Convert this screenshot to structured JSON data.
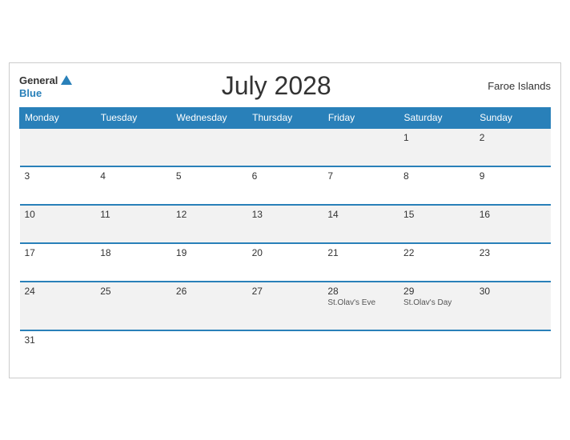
{
  "header": {
    "logo_general": "General",
    "logo_blue": "Blue",
    "month_title": "July 2028",
    "region": "Faroe Islands"
  },
  "weekdays": [
    "Monday",
    "Tuesday",
    "Wednesday",
    "Thursday",
    "Friday",
    "Saturday",
    "Sunday"
  ],
  "weeks": [
    [
      {
        "day": "",
        "event": ""
      },
      {
        "day": "",
        "event": ""
      },
      {
        "day": "",
        "event": ""
      },
      {
        "day": "",
        "event": ""
      },
      {
        "day": "",
        "event": ""
      },
      {
        "day": "1",
        "event": ""
      },
      {
        "day": "2",
        "event": ""
      }
    ],
    [
      {
        "day": "3",
        "event": ""
      },
      {
        "day": "4",
        "event": ""
      },
      {
        "day": "5",
        "event": ""
      },
      {
        "day": "6",
        "event": ""
      },
      {
        "day": "7",
        "event": ""
      },
      {
        "day": "8",
        "event": ""
      },
      {
        "day": "9",
        "event": ""
      }
    ],
    [
      {
        "day": "10",
        "event": ""
      },
      {
        "day": "11",
        "event": ""
      },
      {
        "day": "12",
        "event": ""
      },
      {
        "day": "13",
        "event": ""
      },
      {
        "day": "14",
        "event": ""
      },
      {
        "day": "15",
        "event": ""
      },
      {
        "day": "16",
        "event": ""
      }
    ],
    [
      {
        "day": "17",
        "event": ""
      },
      {
        "day": "18",
        "event": ""
      },
      {
        "day": "19",
        "event": ""
      },
      {
        "day": "20",
        "event": ""
      },
      {
        "day": "21",
        "event": ""
      },
      {
        "day": "22",
        "event": ""
      },
      {
        "day": "23",
        "event": ""
      }
    ],
    [
      {
        "day": "24",
        "event": ""
      },
      {
        "day": "25",
        "event": ""
      },
      {
        "day": "26",
        "event": ""
      },
      {
        "day": "27",
        "event": ""
      },
      {
        "day": "28",
        "event": "St.Olav's Eve"
      },
      {
        "day": "29",
        "event": "St.Olav's Day"
      },
      {
        "day": "30",
        "event": ""
      }
    ],
    [
      {
        "day": "31",
        "event": ""
      },
      {
        "day": "",
        "event": ""
      },
      {
        "day": "",
        "event": ""
      },
      {
        "day": "",
        "event": ""
      },
      {
        "day": "",
        "event": ""
      },
      {
        "day": "",
        "event": ""
      },
      {
        "day": "",
        "event": ""
      }
    ]
  ]
}
